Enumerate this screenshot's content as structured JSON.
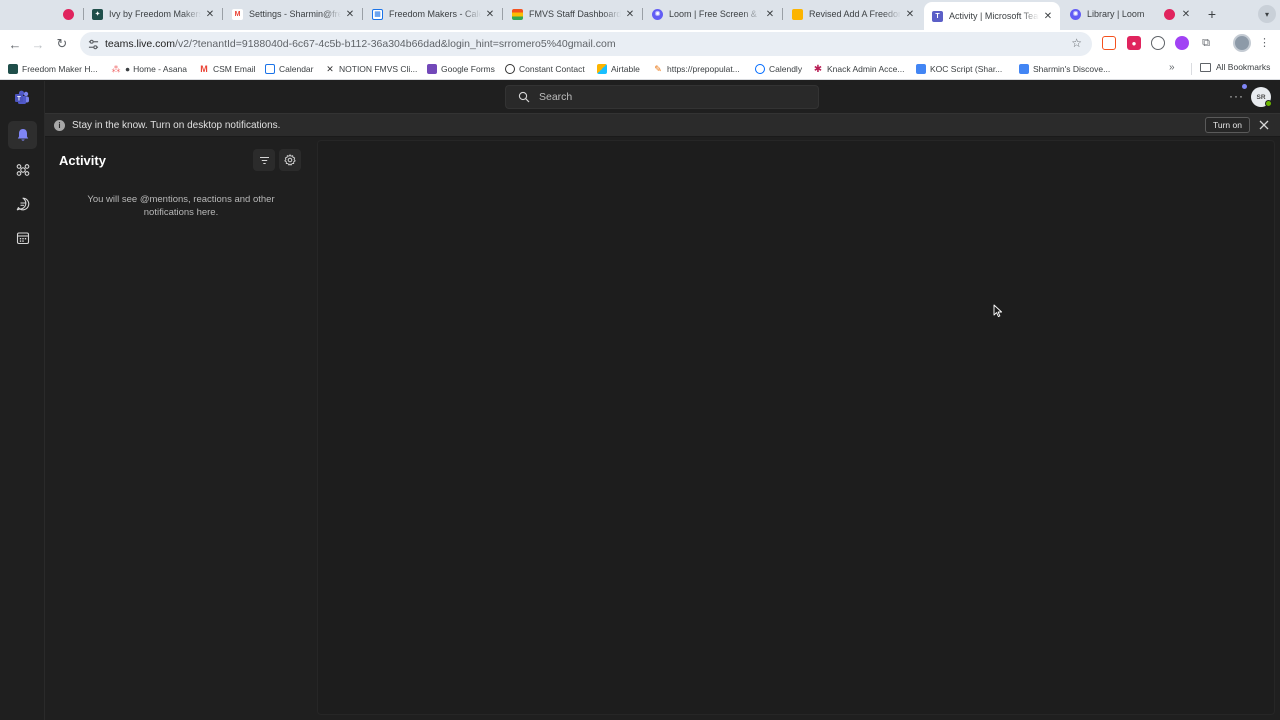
{
  "browser": {
    "tabs": [
      {
        "title": "",
        "favicon": "record-icon",
        "color": "#e0245e"
      },
      {
        "title": "Ivy by Freedom Makers",
        "favicon": "ivy-icon",
        "color": "#1f4e4a"
      },
      {
        "title": "Settings - Sharmin@freedommakers.com",
        "favicon": "gmail-icon",
        "color": "#ea4335"
      },
      {
        "title": "Freedom Makers - Calendar",
        "favicon": "calendar-icon",
        "color": "#1a73e8"
      },
      {
        "title": "FMVS Staff Dashboard | Freedom Makers",
        "favicon": "dashboard-icon",
        "color": "#f4511e"
      },
      {
        "title": "Loom | Free Screen & Video Recording",
        "favicon": "loom-icon",
        "color": "#625df5"
      },
      {
        "title": "Revised Add A Freedom Maker",
        "favicon": "airtable-icon",
        "color": "#fcb400"
      },
      {
        "title": "Activity | Microsoft Teams",
        "favicon": "teams-icon",
        "color": "#5b5fc7"
      },
      {
        "title": "Library | Loom",
        "favicon": "loom-icon",
        "color": "#625df5"
      }
    ],
    "url": {
      "host": "teams.live.com",
      "path": "/v2/?tenantId=9188040d-6c67-4c5b-b112-36a304b66dad&login_hint=srromero5%40gmail.com"
    },
    "bookmarks": [
      {
        "label": "Freedom Maker H...",
        "icon": "freedom-icon",
        "color": "#1f4e4a"
      },
      {
        "label": "Home - Asana",
        "icon": "asana-icon",
        "color": "#f06a6a"
      },
      {
        "label": "CSM Email",
        "icon": "gmail-icon",
        "color": "#ea4335"
      },
      {
        "label": "Calendar",
        "icon": "calendar-icon",
        "color": "#1a73e8"
      },
      {
        "label": "NOTION FMVS Cli...",
        "icon": "notion-icon",
        "color": "#333333"
      },
      {
        "label": "Google Forms",
        "icon": "forms-icon",
        "color": "#7248b9"
      },
      {
        "label": "Constant Contact",
        "icon": "constant-contact-icon",
        "color": "#1856ed"
      },
      {
        "label": "Airtable",
        "icon": "airtable-icon",
        "color": "#fcb400"
      },
      {
        "label": "https://prepopulat...",
        "icon": "link-icon",
        "color": "#e8710a"
      },
      {
        "label": "Calendly",
        "icon": "calendly-icon",
        "color": "#006bff"
      },
      {
        "label": "Knack Admin Acce...",
        "icon": "knack-icon",
        "color": "#b81e55"
      },
      {
        "label": "KOC Script (Shar...",
        "icon": "docs-icon",
        "color": "#4285f4"
      },
      {
        "label": "Sharmin's Discove...",
        "icon": "docs-icon",
        "color": "#4285f4"
      }
    ],
    "all_bookmarks_label": "All Bookmarks"
  },
  "teams": {
    "search_placeholder": "Search",
    "user_initials": "SR",
    "banner": {
      "message": "Stay in the know. Turn on desktop notifications.",
      "turn_on_label": "Turn on"
    },
    "activity": {
      "title": "Activity",
      "empty_message": "You will see @mentions, reactions and other notifications here."
    },
    "colors": {
      "accent": "#7f85f5",
      "background": "#1f1f1f",
      "presence": "#6bb700"
    }
  }
}
